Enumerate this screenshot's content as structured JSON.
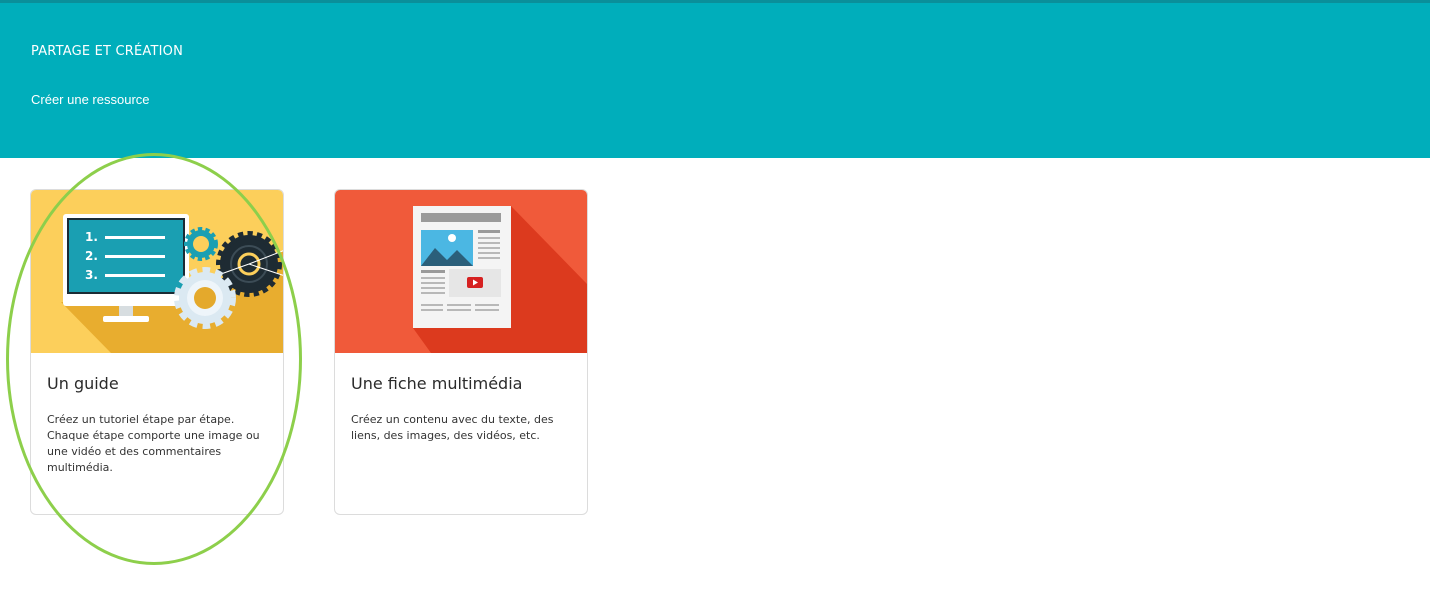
{
  "header": {
    "title": "PARTAGE ET CRÉATION",
    "subtitle": "Créer une ressource",
    "background_color": "#00aebb"
  },
  "cards": [
    {
      "title": "Un guide",
      "description": "Créez un tutoriel étape par étape. Chaque étape comporte une image ou une vidéo et des commentaires multimédia.",
      "illustration": "monitor-gears-illustration",
      "list_numbers": [
        "1.",
        "2.",
        "3."
      ],
      "accent_color": "#fccf5b"
    },
    {
      "title": "Une fiche multimédia",
      "description": "Créez un contenu avec du texte, des liens, des images, des vidéos, etc.",
      "illustration": "document-media-illustration",
      "accent_color": "#f05a3a"
    }
  ],
  "highlight": {
    "target": "Un guide",
    "color": "#8dcf4b",
    "shape": "ellipse"
  }
}
